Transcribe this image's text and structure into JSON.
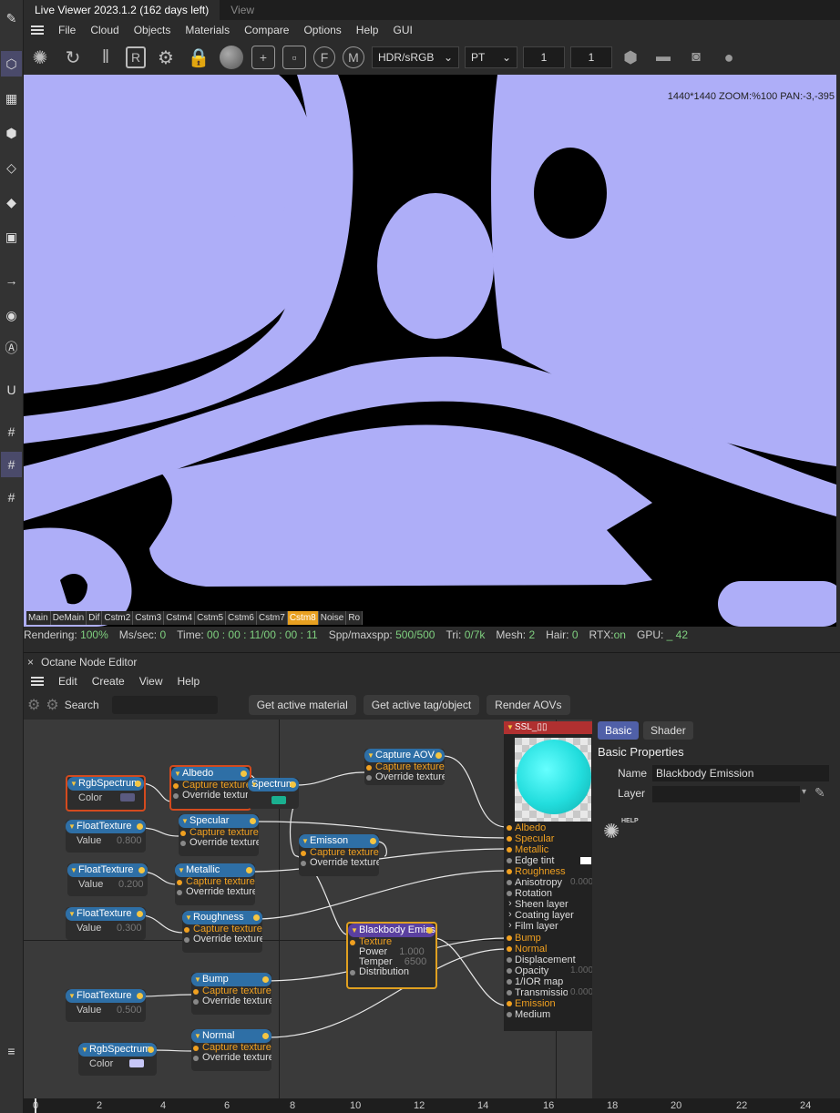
{
  "title_bar": {
    "active_tab": "Live Viewer 2023.1.2 (162 days left)",
    "inactive_tab": "View"
  },
  "menu": [
    "File",
    "Cloud",
    "Objects",
    "Materials",
    "Compare",
    "Options",
    "Help",
    "GUI"
  ],
  "viewer_toolbar": {
    "color_space": "HDR/sRGB",
    "kernel": "PT",
    "num1": "1",
    "num2": "1"
  },
  "viewport": {
    "zoom_info": "1440*1440 ZOOM:%100  PAN:-3,-395",
    "background_color": "#000000",
    "shape_color": "#aeaef8"
  },
  "aov_tabs": [
    "Main",
    "DeMain",
    "Dif",
    "Cstm2",
    "Cstm3",
    "Cstm4",
    "Cstm5",
    "Cstm6",
    "Cstm7",
    "Cstm8",
    "Noise",
    "Ro"
  ],
  "aov_active": "Cstm8",
  "status": {
    "rendering_label": "Rendering:",
    "rendering_value": "100%",
    "ms_label": "Ms/sec:",
    "ms_value": "0",
    "time_label": "Time:",
    "time_value": "00 : 00 : 11/00 : 00 : 11",
    "spp_label": "Spp/maxspp:",
    "spp_value": "500/500",
    "tri_label": "Tri:",
    "tri_value": "0/7k",
    "mesh_label": "Mesh:",
    "mesh_value": "2",
    "hair_label": "Hair:",
    "hair_value": "0",
    "rtx_label": "RTX:",
    "rtx_value": "on",
    "gpu_label": "GPU:",
    "gpu_value": "_ 42"
  },
  "node_editor": {
    "title": "Octane Node Editor",
    "menu": [
      "Edit",
      "Create",
      "View",
      "Help"
    ],
    "search_label": "Search",
    "buttons": [
      "Get active material",
      "Get active tag/object",
      "Render AOVs"
    ],
    "nodes": {
      "rgb1": {
        "title": "RgbSpectrum",
        "label": "Color"
      },
      "albedo": {
        "title": "Albedo",
        "p1": "Capture texture",
        "p2": "Override texture"
      },
      "spectrum": {
        "title": "Spectrum"
      },
      "capture_aov": {
        "title": "Capture AOV",
        "p1": "Capture texture",
        "p2": "Override texture"
      },
      "float1": {
        "title": "FloatTexture",
        "label": "Value",
        "value": "0.800"
      },
      "specular": {
        "title": "Specular",
        "p1": "Capture texture",
        "p2": "Override texture"
      },
      "emisson": {
        "title": "Emisson",
        "p1": "Capture texture",
        "p2": "Override texture"
      },
      "float2": {
        "title": "FloatTexture",
        "label": "Value",
        "value": "0.200"
      },
      "metallic": {
        "title": "Metallic",
        "p1": "Capture texture",
        "p2": "Override texture"
      },
      "float3": {
        "title": "FloatTexture",
        "label": "Value",
        "value": "0.300"
      },
      "roughness": {
        "title": "Roughness",
        "p1": "Capture texture",
        "p2": "Override texture"
      },
      "blackbody": {
        "title": "Blackbody Emission",
        "p1": "Texture",
        "p2": "Power",
        "p2v": "1.000",
        "p3": "Temper",
        "p3v": "6500",
        "p4": "Distribution"
      },
      "float4": {
        "title": "FloatTexture",
        "label": "Value",
        "value": "0.500"
      },
      "bump": {
        "title": "Bump",
        "p1": "Capture texture",
        "p2": "Override texture"
      },
      "normal": {
        "title": "Normal",
        "p1": "Capture texture",
        "p2": "Override texture"
      },
      "rgb2": {
        "title": "RgbSpectrum",
        "label": "Color"
      }
    },
    "output": {
      "title": "SSL_▯▯",
      "pins": [
        "Albedo",
        "Specular",
        "Metallic",
        "Edge tint",
        "Roughness",
        "Anisotropy",
        "Rotation",
        "Sheen layer",
        "Coating layer",
        "Film layer",
        "Bump",
        "Normal",
        "Displacement",
        "Opacity",
        "1/IOR map",
        "Transmission",
        "Emission",
        "Medium"
      ],
      "anisotropy_value": "0.000",
      "opacity_value": "1.000",
      "transmission_value": "0.000"
    }
  },
  "properties": {
    "tab_basic": "Basic",
    "tab_shader": "Shader",
    "section": "Basic Properties",
    "name_label": "Name",
    "name_value": "Blackbody Emission",
    "layer_label": "Layer",
    "help_label": "HELP"
  },
  "timeline": [
    "0",
    "2",
    "4",
    "6",
    "8",
    "10",
    "12",
    "14",
    "16",
    "18",
    "20",
    "22",
    "24"
  ]
}
